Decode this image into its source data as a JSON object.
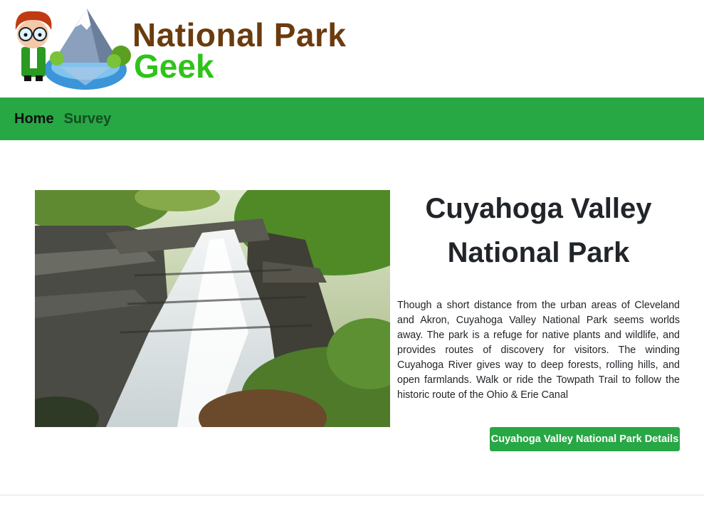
{
  "brand": {
    "line1": "National Park",
    "line2": "Geek",
    "logo_icon": "geek-mascot-mountain-lake-icon",
    "colors": {
      "line1": "#6b3b0e",
      "line2": "#2fc31a"
    }
  },
  "nav": {
    "items": [
      {
        "label": "Home",
        "active": true
      },
      {
        "label": "Survey",
        "active": false
      }
    ],
    "color": "#28a745"
  },
  "park": {
    "image_icon": "waterfall-photo",
    "title": "Cuyahoga Valley National Park",
    "description": "Though a short distance from the urban areas of Cleveland and Akron, Cuyahoga Valley National Park seems worlds away. The park is a refuge for native plants and wildlife, and provides routes of discovery for visitors. The winding Cuyahoga River gives way to deep forests, rolling hills, and open farmlands. Walk or ride the Towpath Trail to follow the historic route of the Ohio & Erie Canal",
    "details_button": "Cuyahoga Valley National Park Details"
  }
}
